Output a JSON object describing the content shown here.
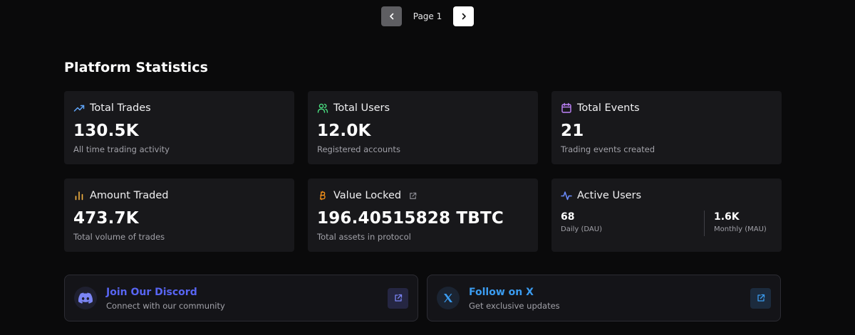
{
  "pagination": {
    "label": "Page 1"
  },
  "section": {
    "title": "Platform Statistics"
  },
  "cards": {
    "total_trades": {
      "title": "Total Trades",
      "value": "130.5K",
      "subtitle": "All time trading activity"
    },
    "total_users": {
      "title": "Total Users",
      "value": "12.0K",
      "subtitle": "Registered accounts"
    },
    "total_events": {
      "title": "Total Events",
      "value": "21",
      "subtitle": "Trading events created"
    },
    "amount_traded": {
      "title": "Amount Traded",
      "value": "473.7K",
      "subtitle": "Total volume of trades"
    },
    "value_locked": {
      "title": "Value Locked",
      "value": "196.40515828 TBTC",
      "subtitle": "Total assets in protocol"
    },
    "active_users": {
      "title": "Active Users",
      "daily": {
        "value": "68",
        "label": "Daily (DAU)"
      },
      "monthly": {
        "value": "1.6K",
        "label": "Monthly (MAU)"
      }
    }
  },
  "social": {
    "discord": {
      "title": "Join Our Discord",
      "subtitle": "Connect with our community",
      "color": "#5865f2"
    },
    "x": {
      "title": "Follow on X",
      "subtitle": "Get exclusive updates",
      "color": "#3b9cf0"
    }
  },
  "colors": {
    "trades_icon": "#60a5fa",
    "users_icon": "#4ade80",
    "events_icon": "#c084fc",
    "amount_icon": "#f5b342",
    "bitcoin_icon": "#f7931a",
    "active_icon": "#6b8cff"
  }
}
